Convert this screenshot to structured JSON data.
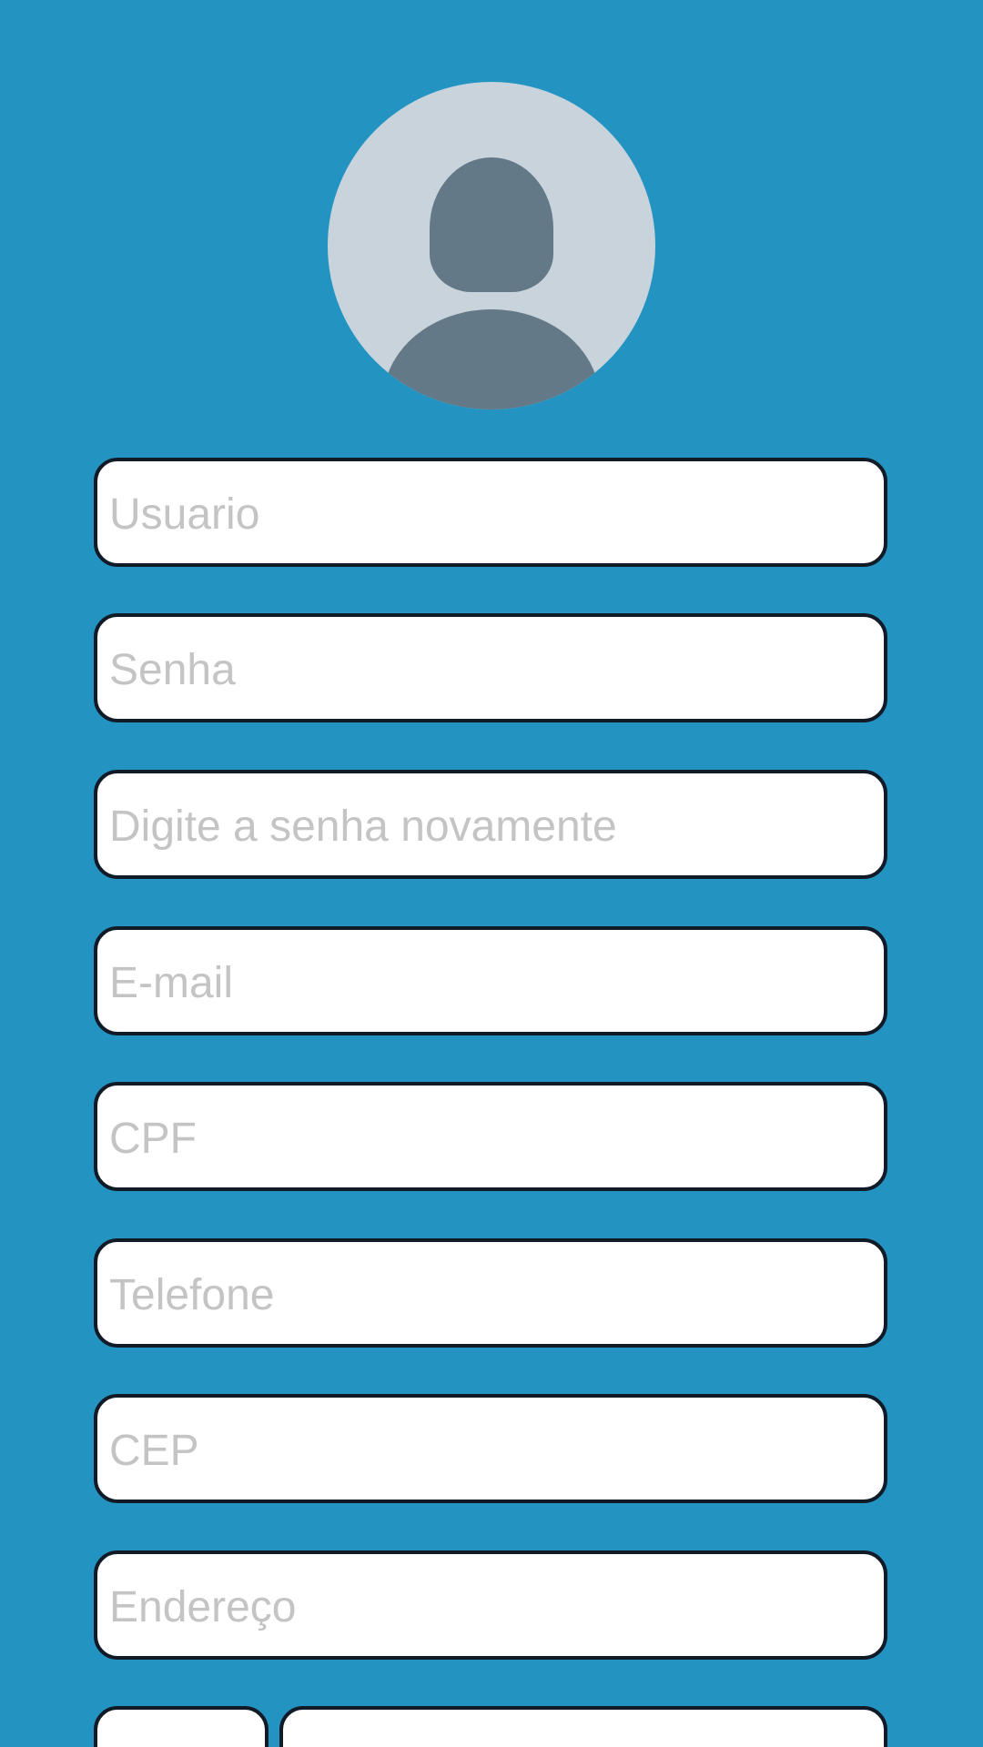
{
  "form": {
    "fields": [
      {
        "placeholder": "Usuario"
      },
      {
        "placeholder": "Senha"
      },
      {
        "placeholder": "Digite a senha novamente"
      },
      {
        "placeholder": "E-mail"
      },
      {
        "placeholder": "CPF"
      },
      {
        "placeholder": "Telefone"
      },
      {
        "placeholder": "CEP"
      },
      {
        "placeholder": "Endereço"
      }
    ]
  },
  "colors": {
    "background": "#2394c1",
    "field_border": "#111a27",
    "placeholder_text": "#c4c4c4",
    "avatar_background": "#c8d3dc",
    "avatar_figure": "#647987"
  },
  "icons": {
    "avatar": "user-avatar-icon"
  }
}
